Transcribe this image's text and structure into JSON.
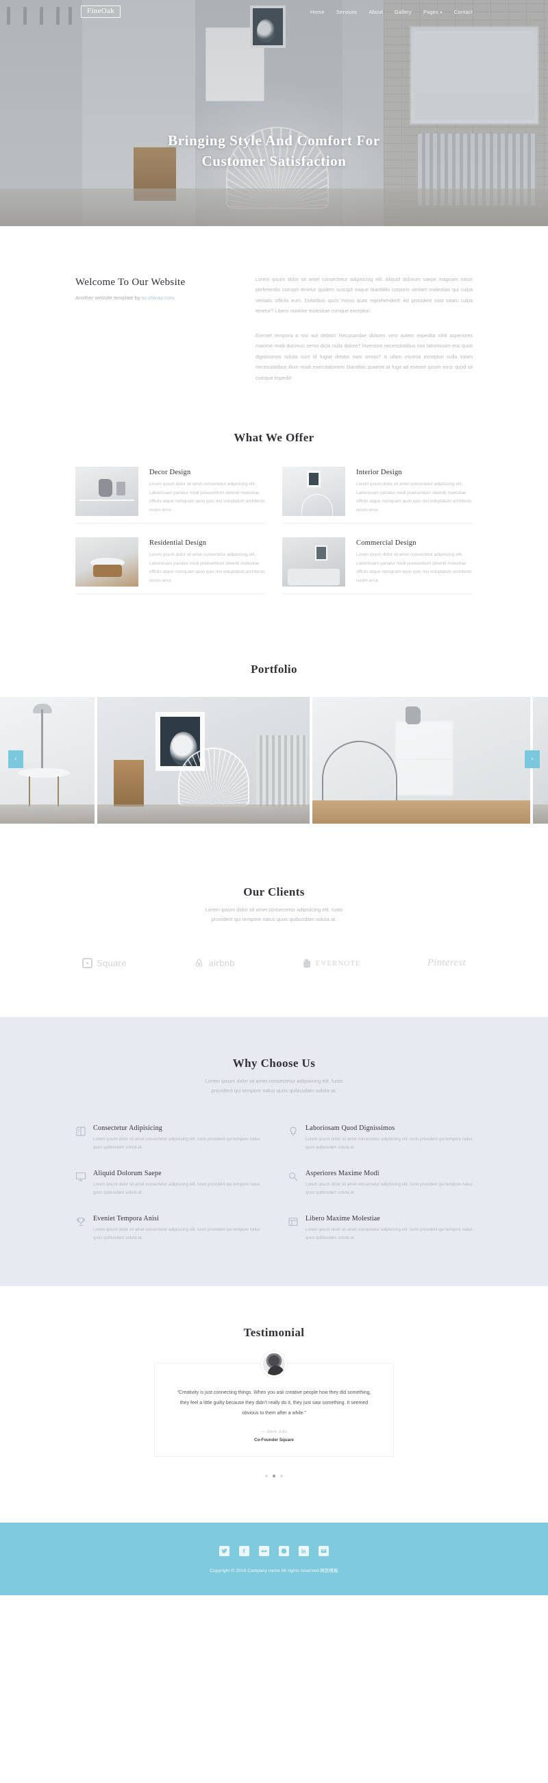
{
  "brand": {
    "logo": "FineOak"
  },
  "nav": {
    "items": [
      {
        "label": "Home"
      },
      {
        "label": "Services"
      },
      {
        "label": "About"
      },
      {
        "label": "Gallery"
      },
      {
        "label": "Pages",
        "caret": "▾"
      },
      {
        "label": "Contact"
      }
    ]
  },
  "hero": {
    "title_line1": "Bringing Style And Comfort For",
    "title_line2": "Customer Satisfaction"
  },
  "welcome": {
    "heading": "Welcome To Our Website",
    "tagline_prefix": "Another website template by ",
    "tagline_link": "sc.chinaz.com",
    "paragraph1": "Lorem ipsum dolor sit amet consectetur adipisicing elit. Aliquid dolorum saepe magnam natus perferendis corrupti tenetur quidem suscipit eaque blanditiis corporis veniam molestias qui culpa veritatis officiis eum. Doloribus quos minus quas reprehenderit! Ad provident sunt totam culpa tenetur? Libero maxime molestiae cumque excepturi.",
    "paragraph2": "Eveniet tempora a nisi aut debitis! Recusandae dolores vero autem expedita nihil asperiores maxime modi ducimus nemo dicta nulla dolore? Inventore necessitatibus non laboriosam eos quod dignissimos soluta sunt id fugiat debitis nam omnis? A ullam minima excepturi nulla totam necessitatibus illum modi exercitationem blanditiis quaerat at fugit ad eveniet ipsum error quod sit cumque impedit!"
  },
  "offer": {
    "title": "What We Offer",
    "cards": [
      {
        "title": "Decor Design",
        "text": "Lorem ipsum dolor sit amet consectetur adipisicing elit. Laboriosam pariatur modi praesentium deleniti molestiae officiis atque numquam quos quis nisi voluptatum architecto rerum error."
      },
      {
        "title": "Interior Design",
        "text": "Lorem ipsum dolor sit amet consectetur adipisicing elit. Laboriosam pariatur modi praesentium deleniti molestiae officiis atque numquam quos quis nisi voluptatum architecto rerum error."
      },
      {
        "title": "Residential Design",
        "text": "Lorem ipsum dolor sit amet consectetur adipisicing elit. Laboriosam pariatur modi praesentium deleniti molestiae officiis atque numquam quos quis nisi voluptatum architecto rerum error."
      },
      {
        "title": "Commercial Design",
        "text": "Lorem ipsum dolor sit amet consectetur adipisicing elit. Laboriosam pariatur modi praesentium deleniti molestiae officiis atque numquam quos quis nisi voluptatum architecto rerum error."
      }
    ]
  },
  "portfolio": {
    "title": "Portfolio",
    "prev_label": "‹",
    "next_label": "›"
  },
  "clients": {
    "title": "Our Clients",
    "subtitle_line1": "Lorem ipsum dolor sit amet consectetur adipisicing elit. Iusto",
    "subtitle_line2": "provident qui tempore natus quos quibusdam soluta at.",
    "logos": [
      {
        "name": "Square"
      },
      {
        "name": "airbnb"
      },
      {
        "name": "EVERNOTE"
      },
      {
        "name": "Pinterest"
      }
    ]
  },
  "why": {
    "title": "Why Choose Us",
    "subtitle_line1": "Lorem ipsum dolor sit amet consectetur adipisicing elit. Iusto",
    "subtitle_line2": "provident qui tempore natus quos quibusdam soluta at.",
    "items": [
      {
        "title": "Consectetur Adipisicing",
        "text": "Lorem ipsum dolor sit amet consectetur adipisicing elit. Iusto provident qui tempore natus quos quibusdam soluta at.",
        "icon": "book-icon"
      },
      {
        "title": "Laboriosam Quod Dignissimos",
        "text": "Lorem ipsum dolor sit amet consectetur adipisicing elit. Iusto provident qui tempore natus quos quibusdam soluta at.",
        "icon": "lightbulb-icon"
      },
      {
        "title": "Aliquid Dolorum Saepe",
        "text": "Lorem ipsum dolor sit amet consectetur adipisicing elit. Iusto provident qui tempore natus quos quibusdam soluta at.",
        "icon": "monitor-icon"
      },
      {
        "title": "Asperiores Maxime Modi",
        "text": "Lorem ipsum dolor sit amet consectetur adipisicing elit. Iusto provident qui tempore natus quos quibusdam soluta at.",
        "icon": "search-icon"
      },
      {
        "title": "Eveniet Tempora Anisi",
        "text": "Lorem ipsum dolor sit amet consectetur adipisicing elit. Iusto provident qui tempore natus quos quibusdam soluta at.",
        "icon": "trophy-icon"
      },
      {
        "title": "Libero Maxime Molestiae",
        "text": "Lorem ipsum dolor sit amet consectetur adipisicing elit. Iusto provident qui tempore natus quos quibusdam soluta at.",
        "icon": "layout-icon"
      }
    ]
  },
  "testimonial": {
    "title": "Testimonial",
    "quote": "“Creativity is just connecting things. When you ask creative people how they did something, they feel a little guilty because they didn’t really do it, they just saw something. It seemed obvious to them after a while.”",
    "author": "— Steve Jobs",
    "role": "Co-Founder Square",
    "dots": 3,
    "active_dot": 1
  },
  "footer": {
    "socials": [
      {
        "name": "twitter-icon"
      },
      {
        "name": "facebook-icon"
      },
      {
        "name": "flickr-icon"
      },
      {
        "name": "dribbble-icon"
      },
      {
        "name": "linkedin-icon"
      },
      {
        "name": "email-icon"
      }
    ],
    "copyright": "Copyright © 2016 Company name All rights reserved.网页模板"
  },
  "colors": {
    "accent": "#7fcadd",
    "why_bg": "#e8eaf1",
    "heading": "#2f3136",
    "muted": "#b4b8bd"
  }
}
